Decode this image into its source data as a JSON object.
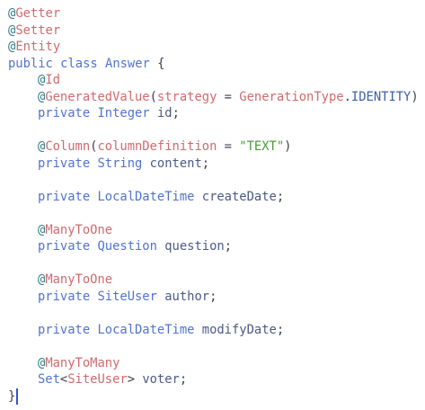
{
  "code": {
    "lines": [
      {
        "at": "@",
        "ann": "Getter"
      },
      {
        "at": "@",
        "ann": "Setter"
      },
      {
        "at": "@",
        "ann": "Entity"
      },
      {
        "kw1": "public",
        "kw2": "class",
        "name": "Answer",
        "brace": "{"
      },
      {
        "at": "@",
        "ann": "Id"
      },
      {
        "at": "@",
        "ann": "GeneratedValue",
        "paren_open": "(",
        "arg": "strategy",
        "eq": " = ",
        "enum_type": "GenerationType",
        "dot": ".",
        "enum_val": "IDENTITY",
        "paren_close": ")"
      },
      {
        "kw": "private",
        "type": "Integer",
        "ident": "id",
        "semi": ";"
      },
      {},
      {
        "at": "@",
        "ann": "Column",
        "paren_open": "(",
        "arg": "columnDefinition",
        "eq": " = ",
        "str": "\"TEXT\"",
        "paren_close": ")"
      },
      {
        "kw": "private",
        "type": "String",
        "ident": "content",
        "semi": ";"
      },
      {},
      {
        "kw": "private",
        "type": "LocalDateTime",
        "ident": "createDate",
        "semi": ";"
      },
      {},
      {
        "at": "@",
        "ann": "ManyToOne"
      },
      {
        "kw": "private",
        "type": "Question",
        "ident": "question",
        "semi": ";"
      },
      {},
      {
        "at": "@",
        "ann": "ManyToOne"
      },
      {
        "kw": "private",
        "type": "SiteUser",
        "ident": "author",
        "semi": ";"
      },
      {},
      {
        "kw": "private",
        "type": "LocalDateTime",
        "ident": "modifyDate",
        "semi": ";"
      },
      {},
      {
        "at": "@",
        "ann": "ManyToMany"
      },
      {
        "type": "Set",
        "lt": "<",
        "generic": "SiteUser",
        "gt": ">",
        "ident": "voter",
        "semi": ";"
      },
      {
        "brace": "}"
      }
    ]
  }
}
